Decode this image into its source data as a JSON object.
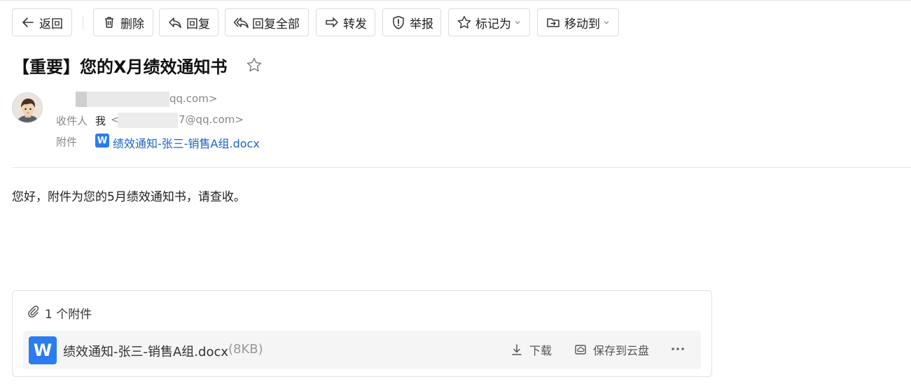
{
  "toolbar": {
    "back": "返回",
    "delete": "删除",
    "reply": "回复",
    "reply_all": "回复全部",
    "forward": "转发",
    "report": "举报",
    "mark_as": "标记为",
    "move_to": "移动到"
  },
  "email": {
    "subject": "【重要】您的X月绩效通知书",
    "sender_address": "qq.com>",
    "recipient_label": "收件人",
    "recipient_name": "我",
    "recipient_lt": "<",
    "recipient_address": "7@qq.com>",
    "attachment_label": "附件",
    "attachment_link": "绩效通知-张三-销售A组.docx",
    "body": "您好，附件为您的5月绩效通知书，请查收。"
  },
  "attachments": {
    "count_text": "1 个附件",
    "items": [
      {
        "name": "绩效通知-张三-销售A组.docx",
        "size": "(8KB)",
        "icon": "W"
      }
    ],
    "download_label": "下载",
    "save_cloud_label": "保存到云盘"
  },
  "colors": {
    "link": "#1a62c8",
    "word_blue": "#2b7cf0"
  }
}
